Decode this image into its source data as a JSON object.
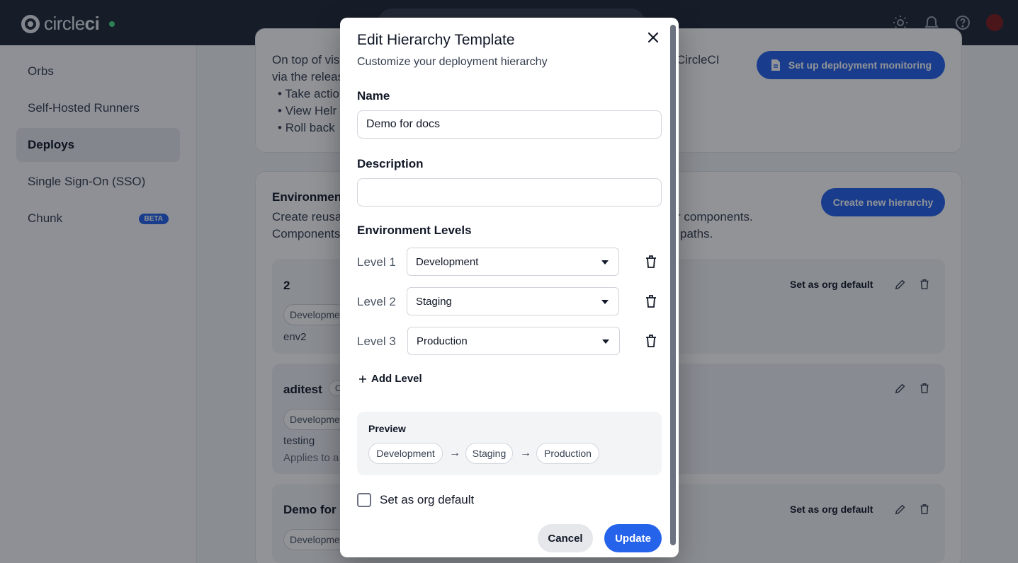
{
  "brand": {
    "name_light": "circle",
    "name_bold": "ci"
  },
  "sidebar": {
    "items": [
      {
        "label": "Orbs"
      },
      {
        "label": "Self-Hosted Runners"
      },
      {
        "label": "Deploys"
      },
      {
        "label": "Single Sign-On (SSO)"
      },
      {
        "label": "Chunk",
        "badge": "BETA"
      }
    ]
  },
  "monitoring": {
    "line1": "On top of vis",
    "line1_tail": "CircleCI",
    "line2": "via the releas",
    "bullets": [
      "Take actio",
      "View Helr",
      "Roll back"
    ],
    "button": "Set up deployment monitoring"
  },
  "environments": {
    "title": "Environment",
    "line1": "Create reusa",
    "line1_tail": "r components.",
    "line2": "Components",
    "line2_tail": "paths.",
    "create_button": "Create new hierarchy",
    "rows": [
      {
        "name": "2",
        "chip": "Developme",
        "desc": "env2",
        "action": "Set as org default"
      },
      {
        "name": "aditest",
        "badge": "O",
        "chip": "Developme",
        "desc": "testing",
        "desc2": "Applies to a"
      },
      {
        "name": "Demo for d",
        "chip": "Developme",
        "action": "Set as org default"
      }
    ]
  },
  "modal": {
    "title": "Edit Hierarchy Template",
    "subtitle": "Customize your deployment hierarchy",
    "name_label": "Name",
    "name_value": "Demo for docs",
    "description_label": "Description",
    "description_value": "",
    "levels_label": "Environment Levels",
    "levels": [
      {
        "label": "Level 1",
        "value": "Development"
      },
      {
        "label": "Level 2",
        "value": "Staging"
      },
      {
        "label": "Level 3",
        "value": "Production"
      }
    ],
    "add_level": "Add Level",
    "preview_title": "Preview",
    "preview_chips": [
      "Development",
      "Staging",
      "Production"
    ],
    "preview_arrow": "→",
    "default_label": "Set as org default",
    "default_checked": false,
    "cancel": "Cancel",
    "update": "Update"
  }
}
